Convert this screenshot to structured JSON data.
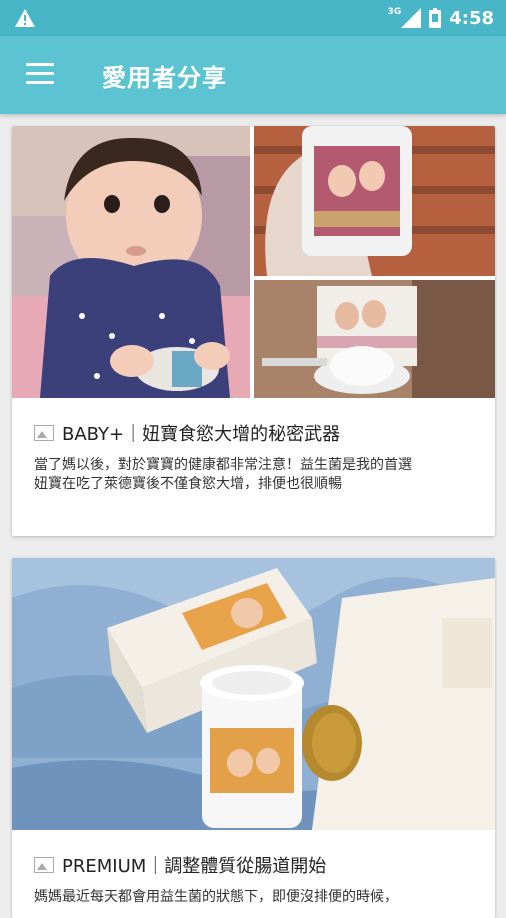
{
  "status_bar": {
    "time": "4:58",
    "network": "3G",
    "alert_icon": "warning-icon",
    "signal_icon": "signal-icon",
    "battery_icon": "battery-icon"
  },
  "app_bar": {
    "title": "愛用者分享",
    "menu_icon": "hamburger-menu-icon"
  },
  "posts": [
    {
      "title": "BABY+｜妞寶食慾大增的秘密武器",
      "description_lines": [
        "當了媽以後，對於寶寶的健康都非常注意！益生菌是我的首選",
        "妞寶在吃了萊德寶後不僅食慾大增，排便也很順暢"
      ],
      "image_icon": "image-icon"
    },
    {
      "title": "PREMIUM｜調整體質從腸道開始",
      "description_lines": [
        "媽媽最近每天都會用益生菌的狀態下，即便沒排便的時候，"
      ],
      "image_icon": "image-icon"
    }
  ],
  "colors": {
    "status_bar": "#48b6c7",
    "app_bar": "#5bc3d1",
    "background": "#ececec"
  }
}
